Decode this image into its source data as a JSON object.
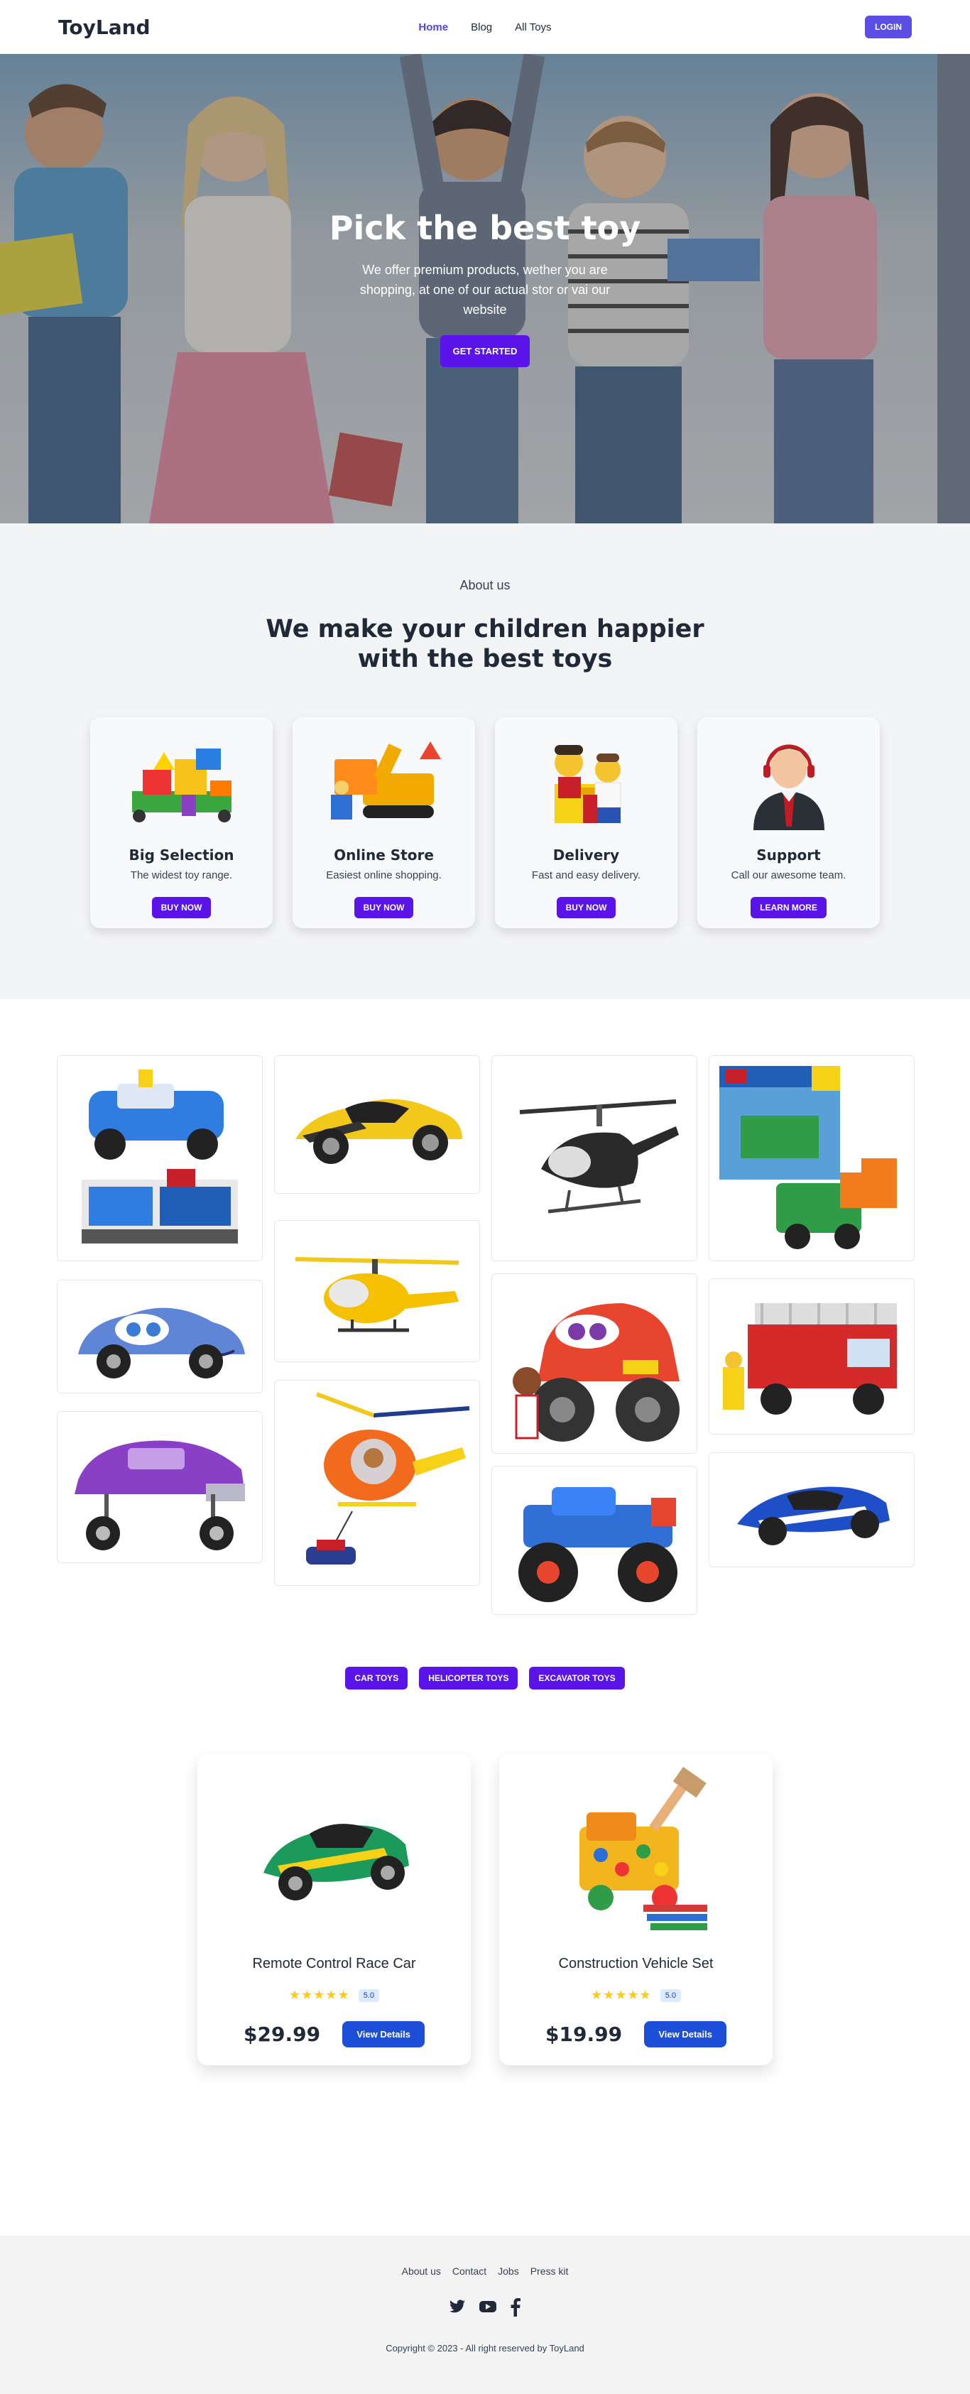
{
  "nav": {
    "logo": "ToyLand",
    "links": [
      "Home",
      "Blog",
      "All Toys"
    ],
    "login": "LOGIN"
  },
  "hero": {
    "title": "Pick the best toy",
    "subtitle": "We offer premium products, wether you are shopping, at one of our actual stor or vai our website",
    "cta": "GET STARTED"
  },
  "about": {
    "kicker": "About us",
    "title_line1": "We make your children happier",
    "title_line2": "with the best toys",
    "cards": [
      {
        "title": "Big Selection",
        "desc": "The widest toy range.",
        "button": "BUY NOW",
        "icon": "toy-playset-icon"
      },
      {
        "title": "Online Store",
        "desc": "Easiest online shopping.",
        "button": "BUY NOW",
        "icon": "construction-toys-icon"
      },
      {
        "title": "Delivery",
        "desc": "Fast and easy delivery.",
        "button": "BUY NOW",
        "icon": "lego-figures-icon"
      },
      {
        "title": "Support",
        "desc": "Call our awesome team.",
        "button": "LEARN MORE",
        "icon": "support-agent-icon"
      }
    ]
  },
  "gallery": {
    "items": [
      "police-lego-set",
      "yellow-sports-car",
      "black-helicopter",
      "lego-creator-box",
      "blue-cartoon-car",
      "yellow-helicopter",
      "red-monster-truck",
      "fire-truck-lego",
      "purple-lowrider-car",
      "orange-rescue-helicopter",
      "blue-monster-truck",
      "blue-race-car"
    ]
  },
  "tabs": [
    "CAR TOYS",
    "HELICOPTER TOYS",
    "EXCAVATOR TOYS"
  ],
  "products": [
    {
      "name": "Remote Control Race Car",
      "stars": "★★★★★",
      "rating": "5.0",
      "price": "$29.99",
      "button": "View Details"
    },
    {
      "name": "Construction Vehicle Set",
      "stars": "★★★★★",
      "rating": "5.0",
      "price": "$19.99",
      "button": "View Details"
    }
  ],
  "footer": {
    "links": [
      "About us",
      "Contact",
      "Jobs",
      "Press kit"
    ],
    "social": [
      "twitter-icon",
      "youtube-icon",
      "facebook-icon"
    ],
    "copyright": "Copyright © 2023 - All right reserved by ToyLand"
  },
  "colors": {
    "primary": "#5a13e9",
    "login": "#5b4ee5",
    "view_details": "#1d4ed8",
    "star": "#facc15"
  }
}
